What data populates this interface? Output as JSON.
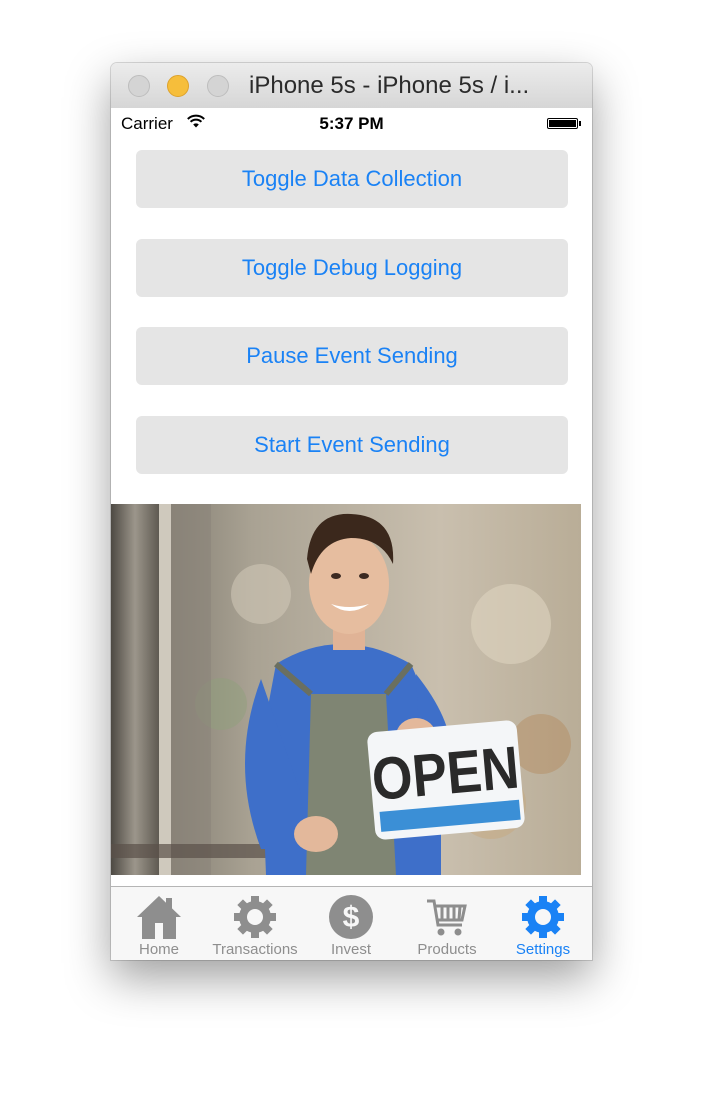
{
  "window": {
    "title": "iPhone 5s - iPhone 5s / i..."
  },
  "statusbar": {
    "carrier": "Carrier",
    "time": "5:37 PM"
  },
  "buttons": [
    {
      "label": "Toggle Data Collection"
    },
    {
      "label": "Toggle Debug Logging"
    },
    {
      "label": "Pause Event Sending"
    },
    {
      "label": "Start Event Sending"
    }
  ],
  "photo": {
    "sign_text": "OPEN"
  },
  "tabs": [
    {
      "label": "Home",
      "icon": "house-icon"
    },
    {
      "label": "Transactions",
      "icon": "gear-icon"
    },
    {
      "label": "Invest",
      "icon": "dollar-coin-icon"
    },
    {
      "label": "Products",
      "icon": "shopping-cart-icon"
    },
    {
      "label": "Settings",
      "icon": "settings-gear-icon",
      "selected": true
    }
  ],
  "colors": {
    "accent": "#1a82f5",
    "inactive_tab": "#8e8e8e",
    "button_bg": "#e5e5e5"
  }
}
